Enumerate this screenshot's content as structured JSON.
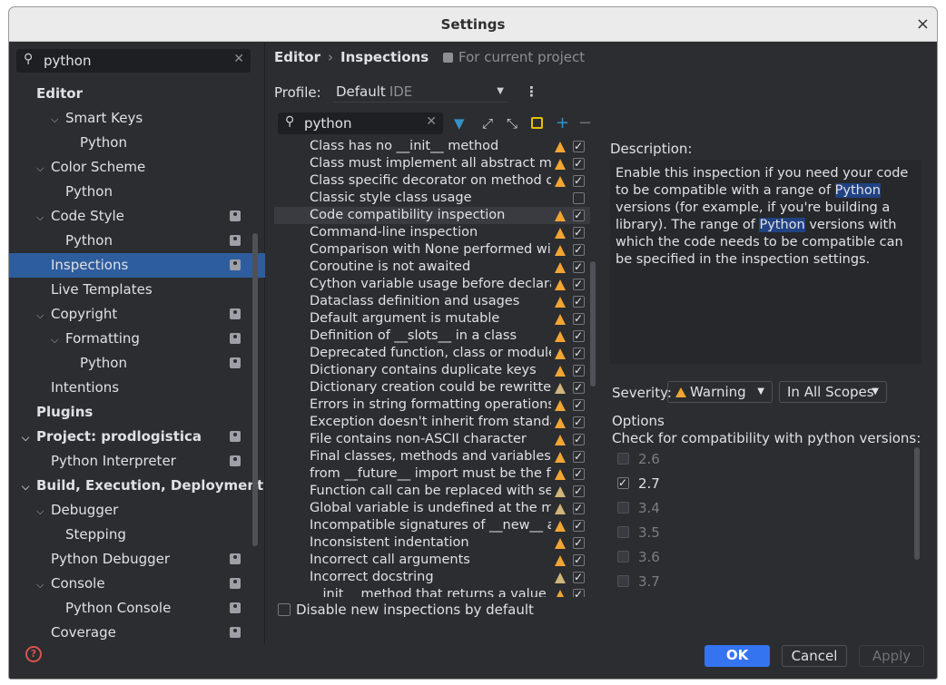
{
  "window": {
    "title": "Settings",
    "close": "×"
  },
  "sidebar": {
    "search_value": "python",
    "items": [
      {
        "label": "Editor",
        "level": 0,
        "bold": true,
        "chev": "",
        "proj": false,
        "sel": false
      },
      {
        "label": "Smart Keys",
        "level": 2,
        "bold": false,
        "chev": "⌄",
        "proj": false,
        "sel": false
      },
      {
        "label": "Python",
        "level": 3,
        "bold": false,
        "chev": "",
        "proj": false,
        "sel": false
      },
      {
        "label": "Color Scheme",
        "level": 1,
        "bold": false,
        "chev": "⌄",
        "proj": false,
        "sel": false
      },
      {
        "label": "Python",
        "level": 2,
        "bold": false,
        "chev": "",
        "proj": false,
        "sel": false
      },
      {
        "label": "Code Style",
        "level": 1,
        "bold": false,
        "chev": "⌄",
        "proj": true,
        "sel": false
      },
      {
        "label": "Python",
        "level": 2,
        "bold": false,
        "chev": "",
        "proj": true,
        "sel": false
      },
      {
        "label": "Inspections",
        "level": 1,
        "bold": false,
        "chev": "",
        "proj": true,
        "sel": true
      },
      {
        "label": "Live Templates",
        "level": 1,
        "bold": false,
        "chev": "",
        "proj": false,
        "sel": false
      },
      {
        "label": "Copyright",
        "level": 1,
        "bold": false,
        "chev": "⌄",
        "proj": true,
        "sel": false
      },
      {
        "label": "Formatting",
        "level": 2,
        "bold": false,
        "chev": "⌄",
        "proj": true,
        "sel": false
      },
      {
        "label": "Python",
        "level": 3,
        "bold": false,
        "chev": "",
        "proj": true,
        "sel": false
      },
      {
        "label": "Intentions",
        "level": 1,
        "bold": false,
        "chev": "",
        "proj": false,
        "sel": false
      },
      {
        "label": "Plugins",
        "level": 0,
        "bold": true,
        "chev": "",
        "proj": false,
        "sel": false
      },
      {
        "label": "Project: prodlogistica",
        "level": 0,
        "bold": true,
        "chev": "⌄",
        "proj": true,
        "sel": false
      },
      {
        "label": "Python Interpreter",
        "level": 1,
        "bold": false,
        "chev": "",
        "proj": true,
        "sel": false
      },
      {
        "label": "Build, Execution, Deployment",
        "level": 0,
        "bold": true,
        "chev": "⌄",
        "proj": false,
        "sel": false
      },
      {
        "label": "Debugger",
        "level": 1,
        "bold": false,
        "chev": "⌄",
        "proj": false,
        "sel": false
      },
      {
        "label": "Stepping",
        "level": 2,
        "bold": false,
        "chev": "",
        "proj": false,
        "sel": false
      },
      {
        "label": "Python Debugger",
        "level": 1,
        "bold": false,
        "chev": "",
        "proj": true,
        "sel": false
      },
      {
        "label": "Console",
        "level": 1,
        "bold": false,
        "chev": "⌄",
        "proj": true,
        "sel": false
      },
      {
        "label": "Python Console",
        "level": 2,
        "bold": false,
        "chev": "",
        "proj": true,
        "sel": false
      },
      {
        "label": "Coverage",
        "level": 1,
        "bold": false,
        "chev": "",
        "proj": true,
        "sel": false
      }
    ]
  },
  "breadcrumb": {
    "parent": "Editor",
    "sep": "›",
    "current": "Inspections",
    "for_project": "For current project"
  },
  "profile": {
    "label": "Profile:",
    "value": "Default",
    "suffix": "IDE"
  },
  "inspection_search": {
    "value": "python"
  },
  "inspections": [
    {
      "name": "Class has no __init__ method",
      "warn": true,
      "dim": false,
      "checked": true,
      "sel": false
    },
    {
      "name": "Class must implement all abstract methods",
      "warn": true,
      "dim": false,
      "checked": true,
      "sel": false
    },
    {
      "name": "Class specific decorator on method outside class",
      "warn": true,
      "dim": false,
      "checked": true,
      "sel": false
    },
    {
      "name": "Classic style class usage",
      "warn": false,
      "dim": false,
      "checked": false,
      "sel": false
    },
    {
      "name": "Code compatibility inspection",
      "warn": true,
      "dim": false,
      "checked": true,
      "sel": true
    },
    {
      "name": "Command-line inspection",
      "warn": true,
      "dim": false,
      "checked": true,
      "sel": false
    },
    {
      "name": "Comparison with None performed with equality operators",
      "warn": true,
      "dim": false,
      "checked": true,
      "sel": false
    },
    {
      "name": "Coroutine is not awaited",
      "warn": true,
      "dim": false,
      "checked": true,
      "sel": false
    },
    {
      "name": "Cython variable usage before declaration",
      "warn": true,
      "dim": false,
      "checked": true,
      "sel": false
    },
    {
      "name": "Dataclass definition and usages",
      "warn": true,
      "dim": false,
      "checked": true,
      "sel": false
    },
    {
      "name": "Default argument is mutable",
      "warn": true,
      "dim": false,
      "checked": true,
      "sel": false
    },
    {
      "name": "Definition of __slots__ in a class",
      "warn": true,
      "dim": false,
      "checked": true,
      "sel": false
    },
    {
      "name": "Deprecated function, class or module",
      "warn": true,
      "dim": false,
      "checked": true,
      "sel": false
    },
    {
      "name": "Dictionary contains duplicate keys",
      "warn": true,
      "dim": false,
      "checked": true,
      "sel": false
    },
    {
      "name": "Dictionary creation could be rewritten by dictionary literal",
      "warn": true,
      "dim": true,
      "checked": true,
      "sel": false
    },
    {
      "name": "Errors in string formatting operations",
      "warn": true,
      "dim": false,
      "checked": true,
      "sel": false
    },
    {
      "name": "Exception doesn't inherit from standard exception class",
      "warn": true,
      "dim": false,
      "checked": true,
      "sel": false
    },
    {
      "name": "File contains non-ASCII character",
      "warn": true,
      "dim": false,
      "checked": true,
      "sel": false
    },
    {
      "name": "Final classes, methods and variables",
      "warn": true,
      "dim": false,
      "checked": true,
      "sel": false
    },
    {
      "name": "from __future__ import must be the first executable statement",
      "warn": true,
      "dim": false,
      "checked": true,
      "sel": false
    },
    {
      "name": "Function call can be replaced with set literal",
      "warn": true,
      "dim": true,
      "checked": true,
      "sel": false
    },
    {
      "name": "Global variable is undefined at the module level",
      "warn": true,
      "dim": true,
      "checked": true,
      "sel": false
    },
    {
      "name": "Incompatible signatures of __new__ and __init__",
      "warn": true,
      "dim": false,
      "checked": true,
      "sel": false
    },
    {
      "name": "Inconsistent indentation",
      "warn": true,
      "dim": false,
      "checked": true,
      "sel": false
    },
    {
      "name": "Incorrect call arguments",
      "warn": true,
      "dim": false,
      "checked": true,
      "sel": false
    },
    {
      "name": "Incorrect docstring",
      "warn": true,
      "dim": true,
      "checked": true,
      "sel": false
    },
    {
      "name": "__init__ method that returns a value",
      "warn": true,
      "dim": false,
      "checked": true,
      "sel": false
    }
  ],
  "disable_new": "Disable new inspections by default",
  "description": {
    "label": "Description:",
    "parts": [
      {
        "t": "Enable this inspection if you need your code to be compatible with a range of ",
        "hl": false
      },
      {
        "t": "Python",
        "hl": true
      },
      {
        "t": " versions (for example, if you're building a library). The range of ",
        "hl": false
      },
      {
        "t": "Python",
        "hl": true
      },
      {
        "t": " versions with which the code needs to be compatible can be specified in the inspection settings.",
        "hl": false
      }
    ]
  },
  "severity": {
    "label": "Severity:",
    "value": "Warning",
    "scope": "In All Scopes"
  },
  "options": {
    "label": "Options",
    "sub": "Check for compatibility with python versions:",
    "versions": [
      {
        "v": "2.6",
        "checked": false
      },
      {
        "v": "2.7",
        "checked": true
      },
      {
        "v": "3.4",
        "checked": false
      },
      {
        "v": "3.5",
        "checked": false
      },
      {
        "v": "3.6",
        "checked": false
      },
      {
        "v": "3.7",
        "checked": false
      }
    ]
  },
  "buttons": {
    "ok": "OK",
    "cancel": "Cancel",
    "apply": "Apply",
    "help": "?"
  },
  "colors": {
    "accent": "#3574f0",
    "selection": "#2e5d9e",
    "warning": "#f2a533",
    "highlight": "#214283"
  }
}
